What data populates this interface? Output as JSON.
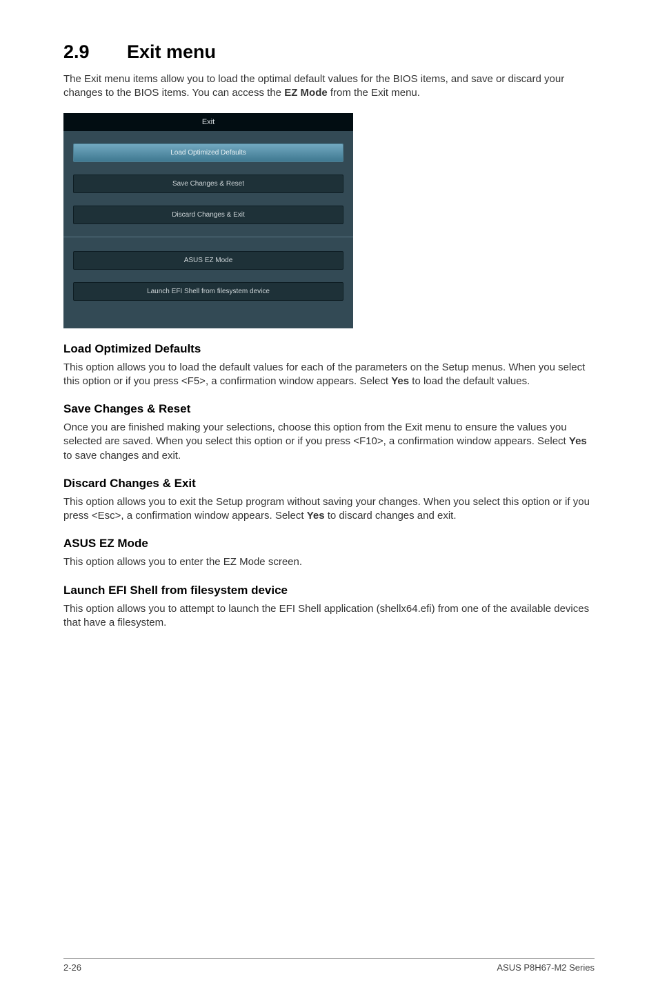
{
  "section": {
    "number": "2.9",
    "title": "Exit menu",
    "intro_part1": "The Exit menu items allow you to load the optimal default values for the BIOS items, and save or discard your changes to the BIOS items. You can access the ",
    "intro_bold": "EZ Mode",
    "intro_part2": " from the Exit menu."
  },
  "bios": {
    "header": "Exit",
    "btn1": "Load Optimized Defaults",
    "btn2": "Save Changes & Reset",
    "btn3": "Discard Changes & Exit",
    "btn4": "ASUS EZ Mode",
    "btn5": "Launch EFI Shell from filesystem device"
  },
  "sub1": {
    "heading": "Load Optimized Defaults",
    "text_part1": "This option allows you to load the default values for each of the parameters on the Setup menus. When you select this option or if you press <F5>, a confirmation window appears. Select ",
    "text_bold": "Yes",
    "text_part2": " to load the default values."
  },
  "sub2": {
    "heading": "Save Changes & Reset",
    "text_part1": "Once you are finished making your selections, choose this option from the Exit menu to ensure the values you selected are saved. When you select this option or if you press <F10>, a confirmation window appears. Select ",
    "text_bold": "Yes",
    "text_part2": " to save changes and exit."
  },
  "sub3": {
    "heading": "Discard Changes & Exit",
    "text_part1": "This option allows you to exit the Setup program without saving your changes. When you select this option or if you press <Esc>, a confirmation window appears. Select ",
    "text_bold": "Yes",
    "text_part2": " to discard changes and exit."
  },
  "sub4": {
    "heading": "ASUS EZ Mode",
    "text": "This option allows you to enter the EZ Mode screen."
  },
  "sub5": {
    "heading": "Launch EFI Shell from filesystem device",
    "text": "This option allows you to attempt to launch the EFI Shell application (shellx64.efi) from one of the available devices that have a filesystem."
  },
  "footer": {
    "page": "2-26",
    "product": "ASUS P8H67-M2 Series"
  }
}
